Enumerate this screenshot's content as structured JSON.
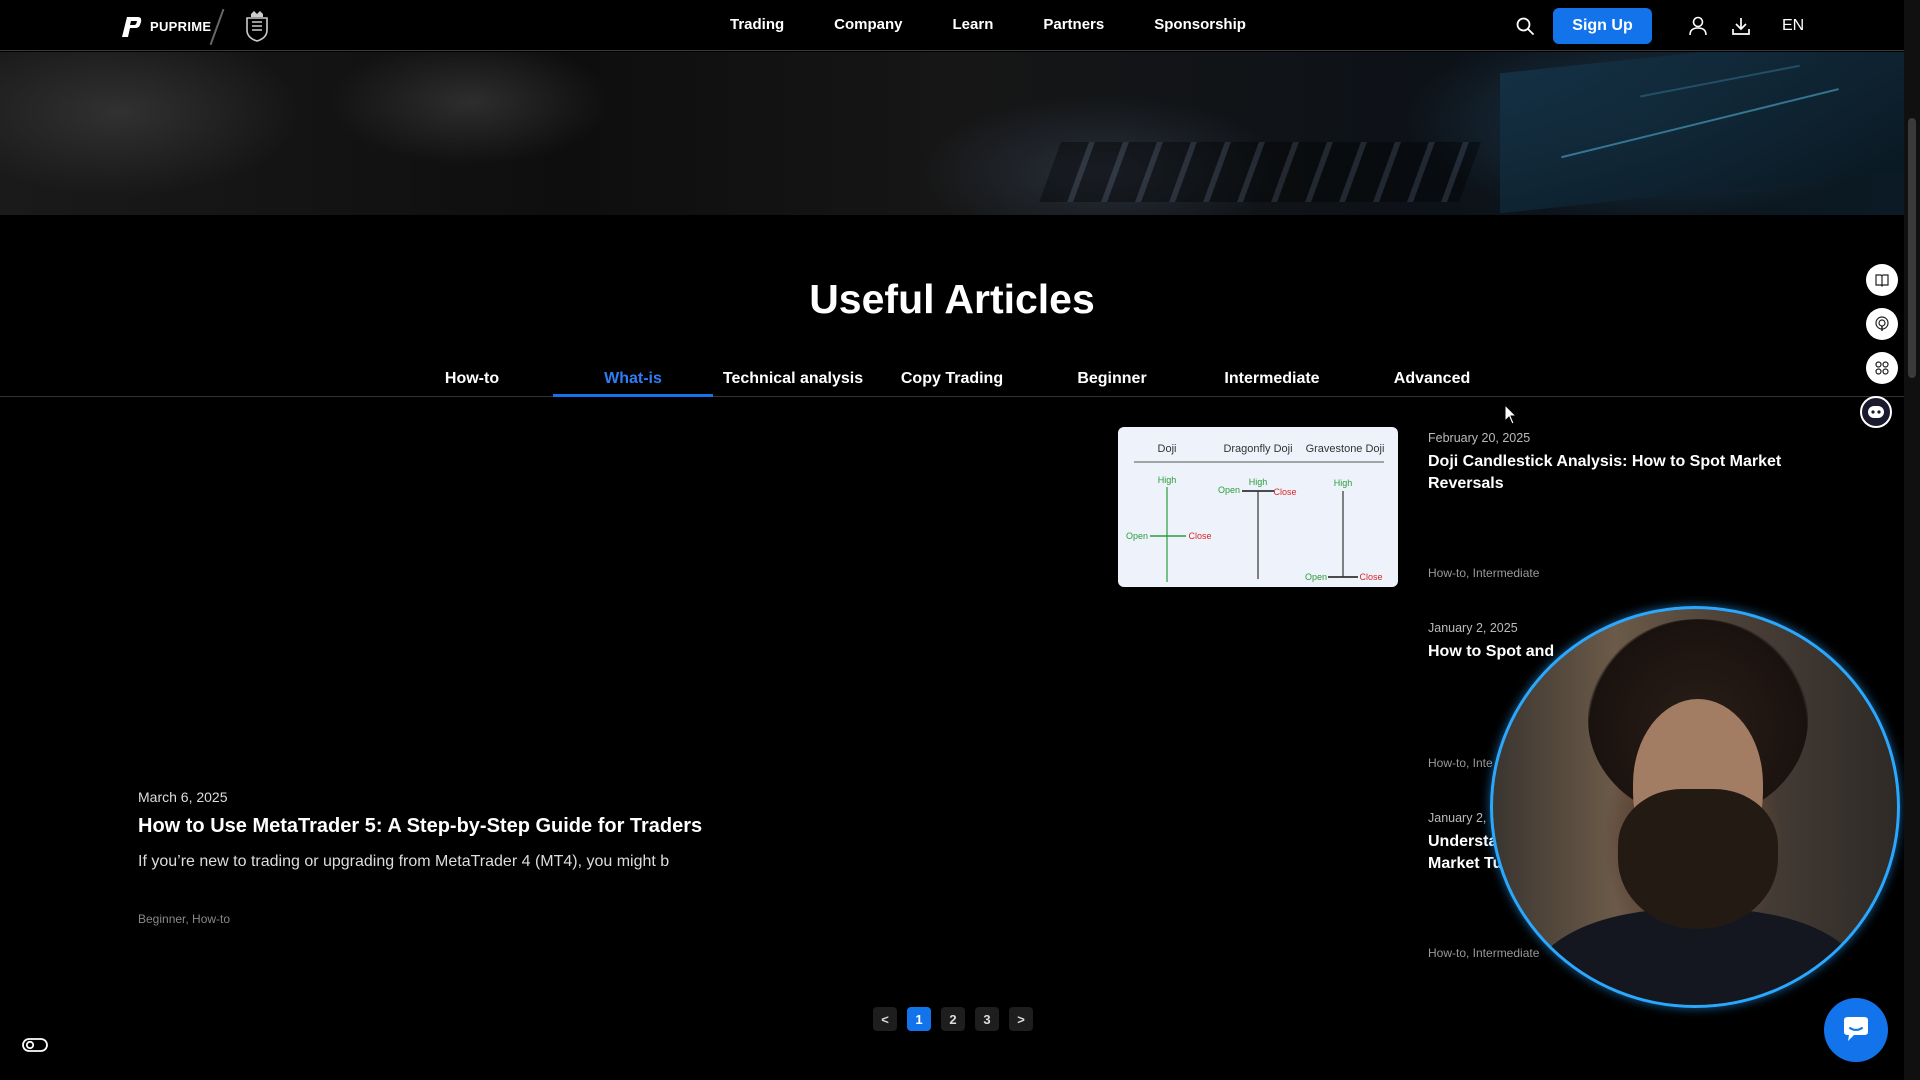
{
  "nav": {
    "brand": "PUPRIME",
    "links": [
      "Trading",
      "Company",
      "Learn",
      "Partners",
      "Sponsorship"
    ],
    "signup_label": "Sign Up",
    "lang": "EN"
  },
  "section": {
    "title": "Useful Articles",
    "tabs": [
      "How-to",
      "What-is",
      "Technical analysis",
      "Copy Trading",
      "Beginner",
      "Intermediate",
      "Advanced"
    ],
    "active_tab": "What-is"
  },
  "featured": {
    "date": "March 6, 2025",
    "title": "How to Use MetaTrader 5: A Step-by-Step Guide for Traders",
    "excerpt": "If you’re new to trading or upgrading from MetaTrader 4 (MT4), you might b",
    "tags": "Beginner, How-to"
  },
  "doji_image": {
    "labels": [
      "Doji",
      "Dragonfly Doji",
      "Gravestone Doji"
    ],
    "high": "High",
    "open": "Open",
    "close": "Close"
  },
  "articles": [
    {
      "date": "February 20, 2025",
      "title": "Doji Candlestick Analysis: How to Spot Market Reversals",
      "tags": "How-to, Intermediate"
    },
    {
      "date": "January 2, 2025",
      "title": "How to Spot and",
      "tags": "How-to, Inte"
    },
    {
      "date": "January 2, 2",
      "title": "Understa",
      "title2": "Market Tu",
      "tags": "How-to, Intermediate"
    }
  ],
  "pagination": {
    "prev": "<",
    "pages": [
      "1",
      "2",
      "3"
    ],
    "next": ">",
    "current": "1"
  },
  "colors": {
    "accent": "#1273eb",
    "active_tab": "#2f7df6",
    "background": "#000000"
  }
}
